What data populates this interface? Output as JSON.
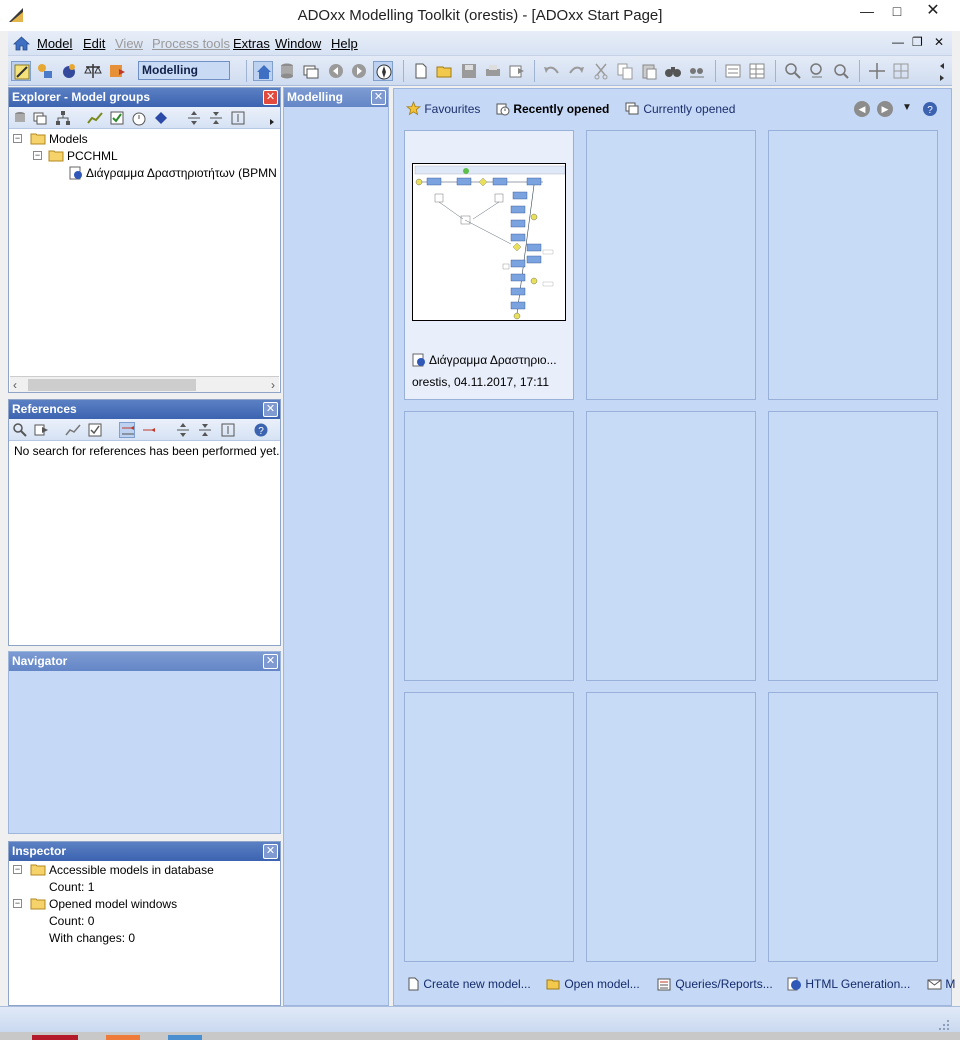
{
  "window": {
    "title": "ADOxx Modelling Toolkit (orestis) - [ADOxx Start Page]"
  },
  "menu": {
    "items": [
      {
        "label": "Model",
        "disabled": false
      },
      {
        "label": "Edit",
        "disabled": false
      },
      {
        "label": "View",
        "disabled": true
      },
      {
        "label": "Process tools",
        "disabled": true
      },
      {
        "label": "Extras",
        "disabled": false
      },
      {
        "label": "Window",
        "disabled": false
      },
      {
        "label": "Help",
        "disabled": false
      }
    ]
  },
  "toolbar": {
    "mode_value": "Modelling"
  },
  "explorer": {
    "title": "Explorer - Model groups",
    "tree": {
      "root": "Models",
      "group": "PCCHML",
      "model": "Διάγραμμα Δραστηριοτήτων (BPMN"
    }
  },
  "modelling_panel": {
    "title": "Modelling"
  },
  "references": {
    "title": "References",
    "message": "No search for references has been performed yet."
  },
  "navigator": {
    "title": "Navigator"
  },
  "inspector": {
    "title": "Inspector",
    "accessible_label": "Accessible models in database",
    "accessible_count": "Count: 1",
    "opened_label": "Opened model windows",
    "opened_count": "Count: 0",
    "opened_changes": "With changes: 0"
  },
  "start_page": {
    "tabs": {
      "favourites": "Favourites",
      "recently_opened": "Recently opened",
      "currently_opened": "Currently opened"
    },
    "recent_card": {
      "name": "Διάγραμμα Δραστηριο...",
      "meta": "orestis, 04.11.2017, 17:11"
    },
    "links": {
      "create": "Create new model...",
      "open": "Open model...",
      "queries": "Queries/Reports...",
      "html": "HTML Generation...",
      "more": "M"
    }
  },
  "colors": {
    "accent": "#3c63b0",
    "pane_bg": "#c5d8f5",
    "close_red": "#e34a3e"
  }
}
